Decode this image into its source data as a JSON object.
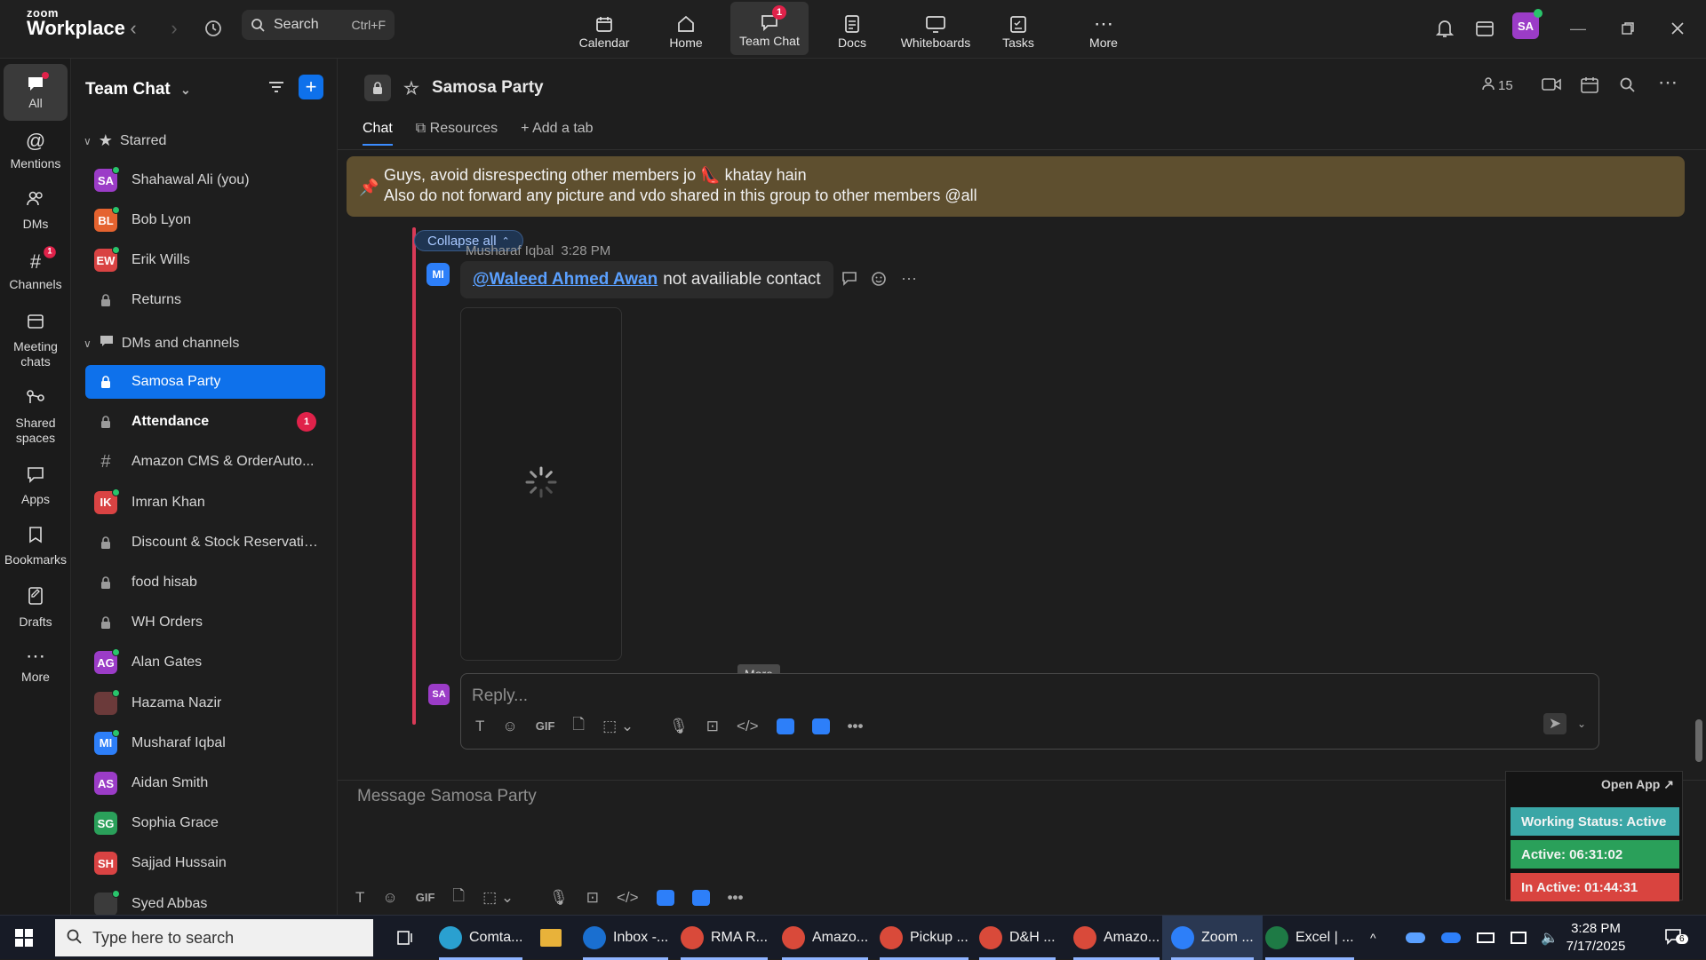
{
  "app": {
    "logo_line1": "zoom",
    "logo_line2": "Workplace",
    "search_label": "Search",
    "search_shortcut": "Ctrl+F",
    "profile_initials": "SA"
  },
  "topnav": [
    {
      "label": "Calendar",
      "icon": "calendar-icon"
    },
    {
      "label": "Home",
      "icon": "home-icon"
    },
    {
      "label": "Team Chat",
      "icon": "chat-icon",
      "badge": "1",
      "active": true
    },
    {
      "label": "Docs",
      "icon": "docs-icon"
    },
    {
      "label": "Whiteboards",
      "icon": "whiteboard-icon"
    },
    {
      "label": "Tasks",
      "icon": "tasks-icon"
    },
    {
      "label": "More",
      "icon": "more-icon"
    }
  ],
  "rail": [
    {
      "label": "All",
      "icon": "chat-bubble-icon",
      "active": true
    },
    {
      "label": "Mentions",
      "icon": "at-icon"
    },
    {
      "label": "DMs",
      "icon": "people-icon"
    },
    {
      "label": "Channels",
      "icon": "hash-icon",
      "badge": "1"
    },
    {
      "label": "Meeting chats",
      "icon": "meeting-icon"
    },
    {
      "label": "Shared spaces",
      "icon": "shared-icon"
    },
    {
      "label": "Apps",
      "icon": "apps-icon"
    },
    {
      "label": "Bookmarks",
      "icon": "bookmark-icon"
    },
    {
      "label": "Drafts",
      "icon": "drafts-icon"
    },
    {
      "label": "More",
      "icon": "ellipsis-icon"
    }
  ],
  "sidebar": {
    "title": "Team Chat",
    "starred_label": "Starred",
    "dms_label": "DMs and channels",
    "starred": [
      {
        "type": "avatar",
        "initials": "SA",
        "color": "#9b3cc7",
        "label": "Shahawal Ali (you)",
        "online": true
      },
      {
        "type": "avatar",
        "initials": "BL",
        "color": "#e5632f",
        "label": "Bob Lyon",
        "online": true
      },
      {
        "type": "avatar",
        "initials": "EW",
        "color": "#d94343",
        "label": "Erik Wills",
        "online": true
      },
      {
        "type": "lock",
        "label": "Returns"
      }
    ],
    "dms": [
      {
        "type": "lock",
        "label": "Samosa Party",
        "selected": true
      },
      {
        "type": "lock",
        "label": "Attendance",
        "bold": true,
        "badge": "1"
      },
      {
        "type": "hash",
        "label": "Amazon CMS & OrderAuto..."
      },
      {
        "type": "avatar",
        "initials": "IK",
        "color": "#d94343",
        "label": "Imran Khan",
        "online": true
      },
      {
        "type": "lock",
        "label": "Discount & Stock Reservatio..."
      },
      {
        "type": "lock",
        "label": "food hisab"
      },
      {
        "type": "lock",
        "label": "WH Orders"
      },
      {
        "type": "avatar",
        "initials": "AG",
        "color": "#9b3cc7",
        "label": "Alan Gates",
        "online": true
      },
      {
        "type": "photo",
        "initials": "",
        "color": "#6b3a3a",
        "label": "Hazama Nazir",
        "online": true
      },
      {
        "type": "avatar",
        "initials": "MI",
        "color": "#2d7ff9",
        "label": "Musharaf Iqbal",
        "online": true
      },
      {
        "type": "avatar",
        "initials": "AS",
        "color": "#9b3cc7",
        "label": "Aidan Smith",
        "online": false
      },
      {
        "type": "avatar",
        "initials": "SG",
        "color": "#2aa05a",
        "label": "Sophia Grace",
        "online": false
      },
      {
        "type": "avatar",
        "initials": "SH",
        "color": "#d94343",
        "label": "Sajjad Hussain",
        "online": false
      },
      {
        "type": "photo",
        "initials": "",
        "color": "#3b3b3b",
        "label": "Syed Abbas",
        "online": true
      }
    ]
  },
  "channel": {
    "name": "Samosa Party",
    "member_count": "15",
    "tabs": [
      "Chat",
      "Resources",
      "Add a tab"
    ],
    "pinned_line1": "Guys, avoid disrespecting other members jo 👠 khatay hain",
    "pinned_line2": "Also do not forward any picture and vdo shared in this group to other members @all",
    "collapse_label": "Collapse all",
    "message": {
      "author": "Musharaf Iqbal",
      "time": "3:28 PM",
      "avatar": "MI",
      "mention": "@Waleed Ahmed Awan",
      "text": "not availiable contact"
    },
    "more_tooltip": "More",
    "reply_placeholder": "Reply...",
    "reply_avatar": "SA",
    "composer_placeholder": "Message Samosa Party"
  },
  "status_widget": {
    "open_app": "Open App ↗",
    "working": "Working Status: Active",
    "active": "Active: 06:31:02",
    "inactive": "In Active: 01:44:31",
    "working_color": "#3aa6a6",
    "active_color": "#2aa05a",
    "inactive_color": "#d9443f"
  },
  "taskbar": {
    "search_placeholder": "Type here to search",
    "apps": [
      "Comta...",
      "Inbox -...",
      "RMA R...",
      "Amazo...",
      "Pickup ...",
      "D&H ...",
      "Amazo...",
      "Zoom ...",
      "Excel | ..."
    ],
    "time": "3:28 PM",
    "date": "7/17/2025",
    "notif_count": "6"
  }
}
